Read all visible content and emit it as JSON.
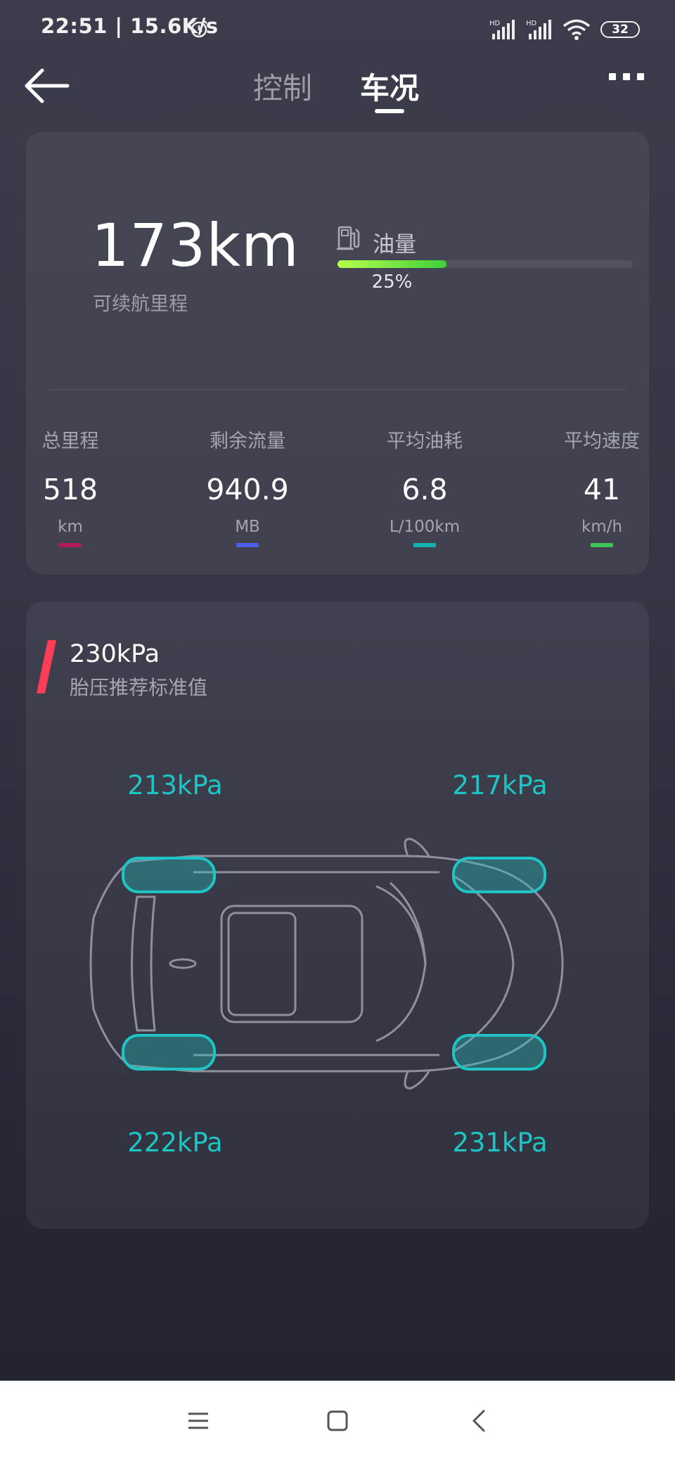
{
  "status_bar": {
    "time_speed": "22:51 | 15.6K/s",
    "battery": "32",
    "signal1_label": "HD",
    "signal2_label": "HD"
  },
  "nav": {
    "tabs": [
      {
        "label": "控制",
        "active": false
      },
      {
        "label": "车况",
        "active": true
      }
    ]
  },
  "range": {
    "value": "173km",
    "label": "可续航里程"
  },
  "fuel": {
    "label": "油量",
    "percent_text": "25%",
    "level": 0.25
  },
  "stats": [
    {
      "label": "总里程",
      "value": "518",
      "unit": "km",
      "color": "#b3195c"
    },
    {
      "label": "剩余流量",
      "value": "940.9",
      "unit": "MB",
      "color": "#4d5fe8"
    },
    {
      "label": "平均油耗",
      "value": "6.8",
      "unit": "L/100km",
      "color": "#17b3b0"
    },
    {
      "label": "平均速度",
      "value": "41",
      "unit": "km/h",
      "color": "#3fc25a"
    }
  ],
  "tire": {
    "standard_value": "230kPa",
    "standard_label": "胎压推荐标准值",
    "front_left": "213kPa",
    "front_right": "217kPa",
    "rear_left": "222kPa",
    "rear_right": "231kPa"
  },
  "colors": {
    "accent": "#ff3d57",
    "tire_highlight": "#1fc4c4"
  }
}
